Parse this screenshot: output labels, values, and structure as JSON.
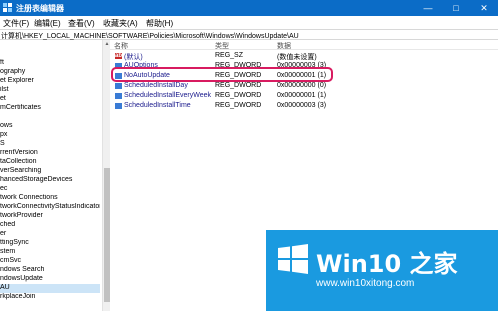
{
  "window": {
    "title": "注册表编辑器"
  },
  "menu": {
    "items": [
      "文件(F)",
      "编辑(E)",
      "查看(V)",
      "收藏夹(A)",
      "帮助(H)"
    ]
  },
  "address": {
    "path": "计算机\\HKEY_LOCAL_MACHINE\\SOFTWARE\\Policies\\Microsoft\\Windows\\WindowsUpdate\\AU"
  },
  "tree": {
    "items": [
      "ft",
      "ography",
      "et Explorer",
      "ilst",
      "et",
      "mCertificates",
      "",
      "ows",
      "px",
      "S",
      "rrentVersion",
      "taCollection",
      "verSearching",
      "hancedStorageDevices",
      "ec",
      "twork Connections",
      "tworkConnectivityStatusIndicator",
      "tworkProvider",
      "ched",
      "er",
      "ttingSync",
      "stem",
      "cmSvc",
      "ndows Search",
      "ndowsUpdate",
      "AU",
      "rkplaceJoin"
    ]
  },
  "list": {
    "columns": {
      "name": "名称",
      "type": "类型",
      "data": "数据"
    },
    "rows": [
      {
        "name": "(默认)",
        "type": "REG_SZ",
        "data": "(数值未设置)",
        "icon": "string-value-icon"
      },
      {
        "name": "AUOptions",
        "type": "REG_DWORD",
        "data": "0x00000003 (3)",
        "icon": "dword-value-icon"
      },
      {
        "name": "NoAutoUpdate",
        "type": "REG_DWORD",
        "data": "0x00000001 (1)",
        "icon": "dword-value-icon"
      },
      {
        "name": "ScheduledInstallDay",
        "type": "REG_DWORD",
        "data": "0x00000000 (0)",
        "icon": "dword-value-icon"
      },
      {
        "name": "ScheduledInstallEveryWeek",
        "type": "REG_DWORD",
        "data": "0x00000001 (1)",
        "icon": "dword-value-icon"
      },
      {
        "name": "ScheduledInstallTime",
        "type": "REG_DWORD",
        "data": "0x00000003 (3)",
        "icon": "dword-value-icon"
      }
    ]
  },
  "watermark": {
    "brand": "Win10 之家",
    "url": "www.win10xitong.com"
  },
  "colors": {
    "titlebar": "#0b6cc7",
    "highlight": "#d81b60",
    "logo_bg": "#1a9ae0"
  }
}
